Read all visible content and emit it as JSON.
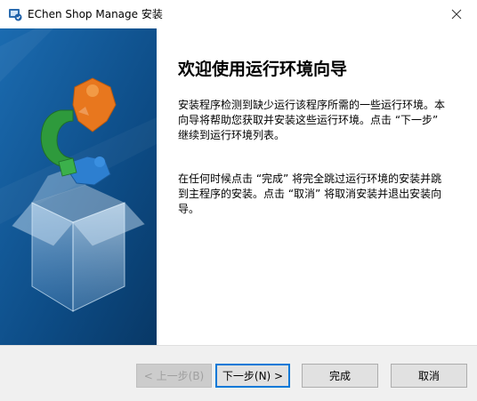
{
  "window": {
    "title": "EChen Shop Manage 安装"
  },
  "icons": {
    "app": "installer-app-icon",
    "close": "close-icon",
    "side_art": "puzzle-box-illustration"
  },
  "wizard": {
    "heading": "欢迎使用运行环境向导",
    "paragraph1": "安装程序检测到缺少运行该程序所需的一些运行环境。本向导将帮助您获取并安装这些运行环境。点击 “下一步” 继续到运行环境列表。",
    "paragraph2": "在任何时候点击 “完成” 将完全跳过运行环境的安装并跳到主程序的安装。点击 “取消” 将取消安装并退出安装向导。"
  },
  "buttons": {
    "back": "< 上一步(B)",
    "next": "下一步(N) >",
    "finish": "完成",
    "cancel": "取消"
  },
  "colors": {
    "side_panel": "#0e4f8a",
    "puzzle_orange": "#e8771e",
    "puzzle_green": "#2e9a3c",
    "puzzle_blue": "#2d7fd0",
    "default_button_border": "#0078d7"
  }
}
